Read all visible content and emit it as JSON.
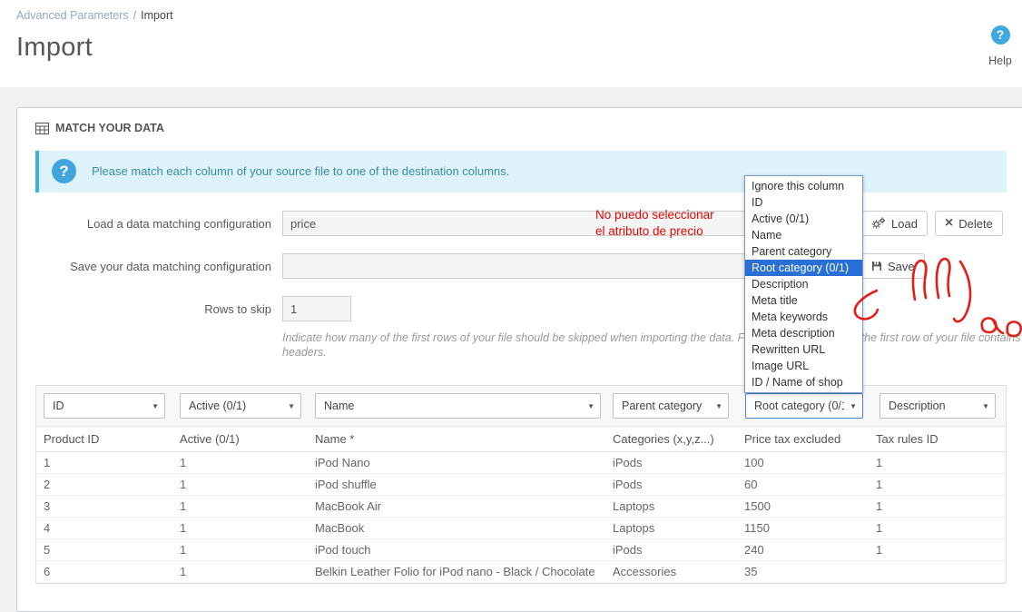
{
  "breadcrumb": {
    "parent": "Advanced Parameters",
    "separator": "/",
    "current": "Import"
  },
  "header": {
    "title": "Import",
    "help": "Help",
    "help_glyph": "?"
  },
  "panel": {
    "title": "MATCH YOUR DATA"
  },
  "alert": {
    "glyph": "?",
    "message": "Please match each column of your source file to one of the destination columns."
  },
  "form": {
    "load": {
      "label": "Load a data matching configuration",
      "value": "price",
      "load_button": "Load",
      "delete_button": "Delete"
    },
    "save": {
      "label": "Save your data matching configuration",
      "value": "",
      "save_button": "Save"
    },
    "rows_to_skip": {
      "label": "Rows to skip",
      "value": "1",
      "hint": "Indicate how many of the first rows of your file should be skipped when importing the data. For instance set it to 1 if the first row of your file contains headers."
    }
  },
  "annotation": {
    "line1": "No puedo seleccionar",
    "line2": "el atributo de precio",
    "color": "#e10600"
  },
  "dropdown": {
    "items": [
      "Ignore this column",
      "ID",
      "Active (0/1)",
      "Name",
      "Parent category",
      "Root category (0/1)",
      "Description",
      "Meta title",
      "Meta keywords",
      "Meta description",
      "Rewritten URL",
      "Image URL",
      "ID / Name of shop"
    ],
    "selected": "Root category (0/1)",
    "selected_index": 5,
    "highlight_color": "#2a6fd6"
  },
  "column_selects": [
    "ID",
    "Active (0/1)",
    "Name",
    "Parent category",
    "Root category (0/1)",
    "Description"
  ],
  "preview_table": {
    "headers": [
      "Product ID",
      "Active (0/1)",
      "Name *",
      "Categories (x,y,z...)",
      "Price tax excluded",
      "Tax rules ID"
    ],
    "rows": [
      [
        "1",
        "1",
        "iPod Nano",
        "iPods",
        "100",
        "1"
      ],
      [
        "2",
        "1",
        "iPod shuffle",
        "iPods",
        "60",
        "1"
      ],
      [
        "3",
        "1",
        "MacBook Air",
        "Laptops",
        "1500",
        "1"
      ],
      [
        "4",
        "1",
        "MacBook",
        "Laptops",
        "1150",
        "1"
      ],
      [
        "5",
        "1",
        "iPod touch",
        "iPods",
        "240",
        "1"
      ],
      [
        "6",
        "1",
        "Belkin Leather Folio for iPod nano - Black / Chocolate",
        "Accessories",
        "35",
        ""
      ]
    ]
  }
}
